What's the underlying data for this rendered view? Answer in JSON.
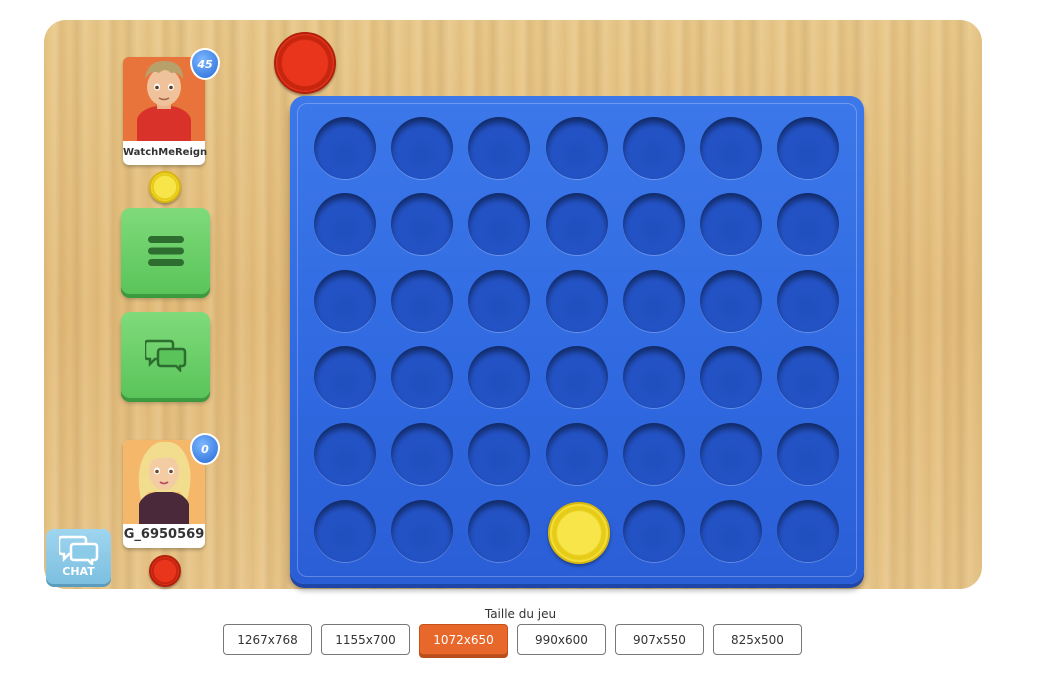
{
  "players": [
    {
      "name": "WatchMeReign",
      "level": "45",
      "chip_color": "yellow"
    },
    {
      "name": "G_6950569",
      "level": "0",
      "chip_color": "red"
    }
  ],
  "current_turn_chip": "red",
  "chat_label": "CHAT",
  "board": {
    "columns": 7,
    "rows": 6,
    "cells": [
      [
        "",
        "",
        "",
        "",
        "",
        "",
        ""
      ],
      [
        "",
        "",
        "",
        "",
        "",
        "",
        ""
      ],
      [
        "",
        "",
        "",
        "",
        "",
        "",
        ""
      ],
      [
        "",
        "",
        "",
        "",
        "",
        "",
        ""
      ],
      [
        "",
        "",
        "",
        "",
        "",
        "",
        ""
      ],
      [
        "",
        "",
        "",
        "yellow",
        "",
        "",
        ""
      ]
    ]
  },
  "size_selector": {
    "title": "Taille du jeu",
    "options": [
      "1267x768",
      "1155x700",
      "1072x650",
      "990x600",
      "907x550",
      "825x500"
    ],
    "selected": "1072x650"
  },
  "colors": {
    "board_blue": "#2f68e0",
    "yellow_chip": "#f7e54a",
    "red_chip": "#e8351c",
    "button_green": "#5ac45a",
    "selected_size": "#e8672b"
  }
}
